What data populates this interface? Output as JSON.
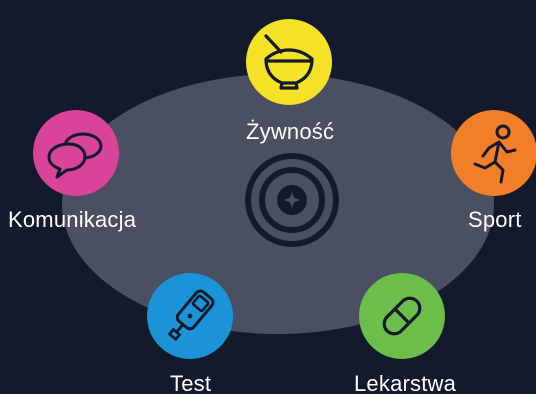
{
  "menu": {
    "items": [
      {
        "id": "food",
        "label": "Żywność",
        "icon": "bowl-icon",
        "color": "#f5e125"
      },
      {
        "id": "sport",
        "label": "Sport",
        "icon": "running-person-icon",
        "color": "#f27f27"
      },
      {
        "id": "medicines",
        "label": "Lekarstwa",
        "icon": "pill-icon",
        "color": "#6dbd4a"
      },
      {
        "id": "test",
        "label": "Test",
        "icon": "glucose-meter-icon",
        "color": "#1b93d9"
      },
      {
        "id": "communication",
        "label": "Komunikacja",
        "icon": "chat-bubbles-icon",
        "color": "#d9449a"
      }
    ],
    "center_icon": "add-icon"
  },
  "colors": {
    "background": "#131a2c",
    "ellipse": "#4a5061",
    "icon_stroke": "#131a2c"
  }
}
